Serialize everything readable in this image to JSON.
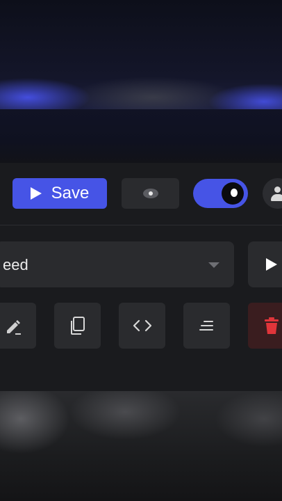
{
  "toolbar": {
    "save_label": "Save"
  },
  "editor": {
    "select_value": "eed"
  },
  "colors": {
    "accent": "#4654e6",
    "surface": "#2a2b2e",
    "panel": "#1a1b1e",
    "danger": "#e0353a"
  },
  "icons": {
    "save": "play-icon",
    "preview": "eye-icon",
    "toggle": "toggle-switch",
    "profile": "user-icon",
    "dropdown": "chevron-down-icon",
    "run": "play-icon",
    "edit": "pencil-icon",
    "copy": "copy-icon",
    "code": "code-icon",
    "format": "align-lines-icon",
    "delete": "trash-icon"
  }
}
